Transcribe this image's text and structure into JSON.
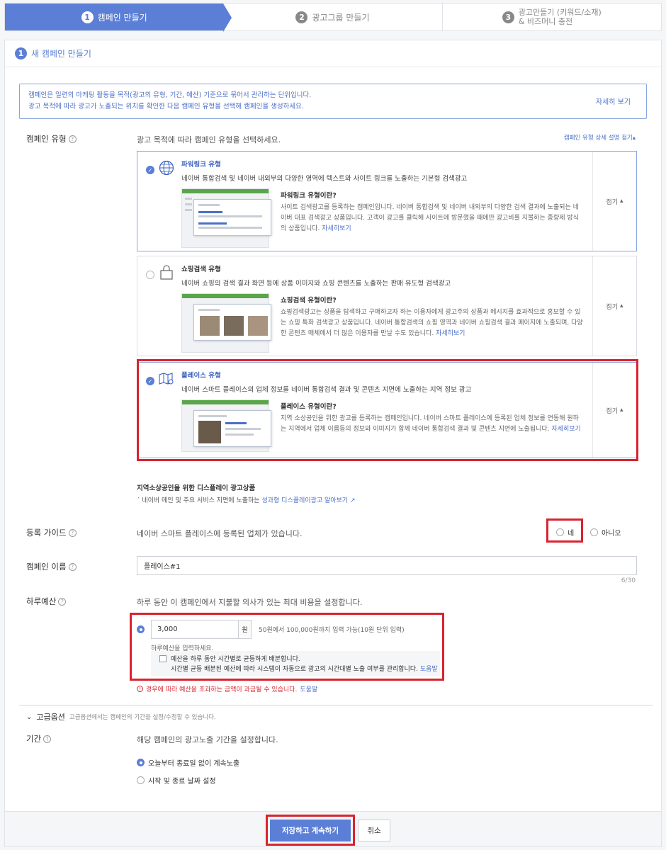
{
  "stepper": {
    "steps": [
      {
        "num": "1",
        "label": "캠페인 만들기"
      },
      {
        "num": "2",
        "label": "광고그룹 만들기"
      },
      {
        "num": "3",
        "label_line1": "광고만들기 (키워드/소재)",
        "label_line2": "& 비즈머니 충전"
      }
    ]
  },
  "panel": {
    "num": "1",
    "title": "새 캠페인 만들기"
  },
  "info": {
    "line1": "캠페인은 일련의 마케팅 활동을 목적(광고의 유형, 기간, 예산) 기준으로 묶어서 관리하는 단위입니다.",
    "line2": "광고 목적에 따라 광고가 노출되는 위치를 확인한 다음 캠페인 유형을 선택해 캠페인을 생성하세요.",
    "more": "자세히 보기"
  },
  "campaign_type": {
    "label": "캠페인 유형",
    "desc": "광고 목적에 따라 캠페인 유형을 선택하세요.",
    "detail_toggle": "캠페인 유형 상세 설명 접기▴",
    "fold_label": "접기",
    "cards": [
      {
        "title": "파워링크 유형",
        "sub": "네이버 통합검색 및 네이버 내외부의 다양한 영역에 텍스트와 사이트 링크를 노출하는 기본형 검색광고",
        "detail_title": "파워링크 유형이란?",
        "detail_text": "사이트 검색광고를 등록하는 캠페인입니다. 네이버 통합검색 및 네이버 내외부의 다양한 검색 결과에 노출되는 네이버 대표 검색광고 상품입니다. 고객이 광고를 클릭해 사이트에 방문했을 때에만 광고비를 지불하는 종량제 방식의 상품입니다. ",
        "link": "자세히보기"
      },
      {
        "title": "쇼핑검색 유형",
        "sub": "네이버 쇼핑의 검색 결과 화면 등에 상품 이미지와 쇼핑 콘텐츠를 노출하는 판매 유도형 검색광고",
        "detail_title": "쇼핑검색 유형이란?",
        "detail_text": "쇼핑검색광고는 상품을 탐색하고 구매하고자 하는 이용자에게 광고주의 상품과 메시지를 효과적으로 홍보할 수 있는 쇼핑 특화 검색광고 상품입니다. 네이버 통합검색의 쇼핑 영역과 네이버 쇼핑검색 결과 페이지에 노출되며, 다양한 콘텐츠 매체에서 더 많은 이용자를 만날 수도 있습니다. ",
        "link": "자세히보기"
      },
      {
        "title": "플레이스 유형",
        "sub": "네이버 스마트 플레이스의 업체 정보를 네이버 통합검색 결과 및 콘텐츠 지면에 노출하는 지역 정보 광고",
        "detail_title": "플레이스 유형이란?",
        "detail_text": "지역 소상공인을 위한 광고를 등록하는 캠페인입니다. 네이버 스마트 플레이스에 등록된 업체 정보를 연동해 원하는 지역에서 업체 이름등의 정보와 이미지가 함께 네이버 통합검색 결과 및 콘텐츠 지면에 노출됩니다. ",
        "link": "자세히보기"
      }
    ]
  },
  "display": {
    "title": "지역소상공인을 위한 디스플레이 광고상품",
    "sub": "ˊ 네이버 메인 및 주요 서비스 지면에 노출하는 ",
    "link": "성과형 디스플레이광고 알아보기"
  },
  "guide": {
    "label": "등록 가이드",
    "desc": "네이버 스마트 플레이스에 등록된 업체가 있습니다.",
    "yes": "네",
    "no": "아니오"
  },
  "campaign_name": {
    "label": "캠페인 이름",
    "value": "플레이스#1",
    "counter": "6/30"
  },
  "budget": {
    "label": "하루예산",
    "desc": "하루 동안 이 캠페인에서 지불할 의사가 있는 최대 비용을 설정합니다.",
    "value": "3,000",
    "unit": "원",
    "hint": "50원에서 100,000원까지 입력 가능(10원 단위 입력)",
    "required": "하루예산을 입력하세요.",
    "split_line1": "예산을 하루 동안 시간별로 균등하게 배분합니다.",
    "split_line2": "시간별 균등 배분된 예산에 따라 시스템이 자동으로 광고의 시간대별 노출 여부를 관리합니다. ",
    "help": "도움말",
    "warning": "경우에 따라 예산을 초과하는 금액이 과금될 수 있습니다. ",
    "warning_help": "도움말"
  },
  "advanced": {
    "title": "고급옵션",
    "sub": "고급옵션에서는 캠페인의 기간을 설정/수정할 수 있습니다."
  },
  "period": {
    "label": "기간",
    "desc": "해당 캠페인의 광고노출 기간을 설정합니다.",
    "opt1": "오늘부터 종료일 없이 계속노출",
    "opt2": "시작 및 종료 날짜 설정"
  },
  "buttons": {
    "save": "저장하고 계속하기",
    "cancel": "취소"
  },
  "colors": {
    "accent": "#5b7fd6",
    "highlight": "#d9232e"
  }
}
